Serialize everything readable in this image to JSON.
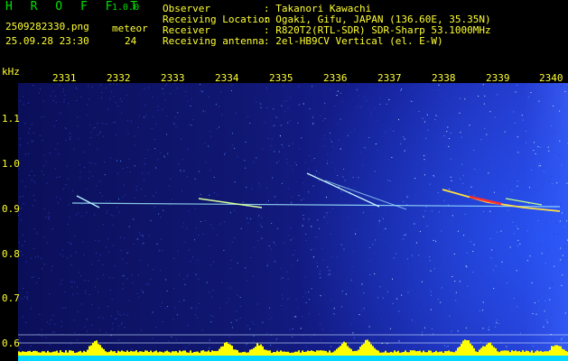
{
  "header": {
    "app_name": "H R O F F T",
    "app_version": "1.0.0",
    "file_name": "2509282330.png",
    "meteor_label": "meteor",
    "datetime": "25.09.28 23:30",
    "meteor_count": "24"
  },
  "info": [
    {
      "key": "Observer",
      "value": ": Takanori Kawachi"
    },
    {
      "key": "Receiving Location",
      "value": ": Ogaki, Gifu, JAPAN (136.60E, 35.35N)"
    },
    {
      "key": "Receiver",
      "value": ": R820T2(RTL-SDR) SDR-Sharp 53.1000MHz"
    },
    {
      "key": "Receiving antenna",
      "value": ": 2el-HB9CV Vertical (el. E-W)"
    }
  ],
  "axes": {
    "y_unit": "kHz",
    "x_ticks": [
      "2331",
      "2332",
      "2333",
      "2334",
      "2335",
      "2336",
      "2337",
      "2338",
      "2339",
      "2340"
    ],
    "y_ticks": [
      "1.1",
      "1.0",
      "0.9",
      "0.8",
      "0.7",
      "0.6"
    ]
  },
  "colors": {
    "label": "#ffff33",
    "title": "#00e000",
    "background": "#000000",
    "spectrum_base": "#101772",
    "signal": "#9fe8ff",
    "signal_hot": "#ff3030",
    "power_bars": "#ffff00",
    "baseline": "#00d8ff"
  }
}
